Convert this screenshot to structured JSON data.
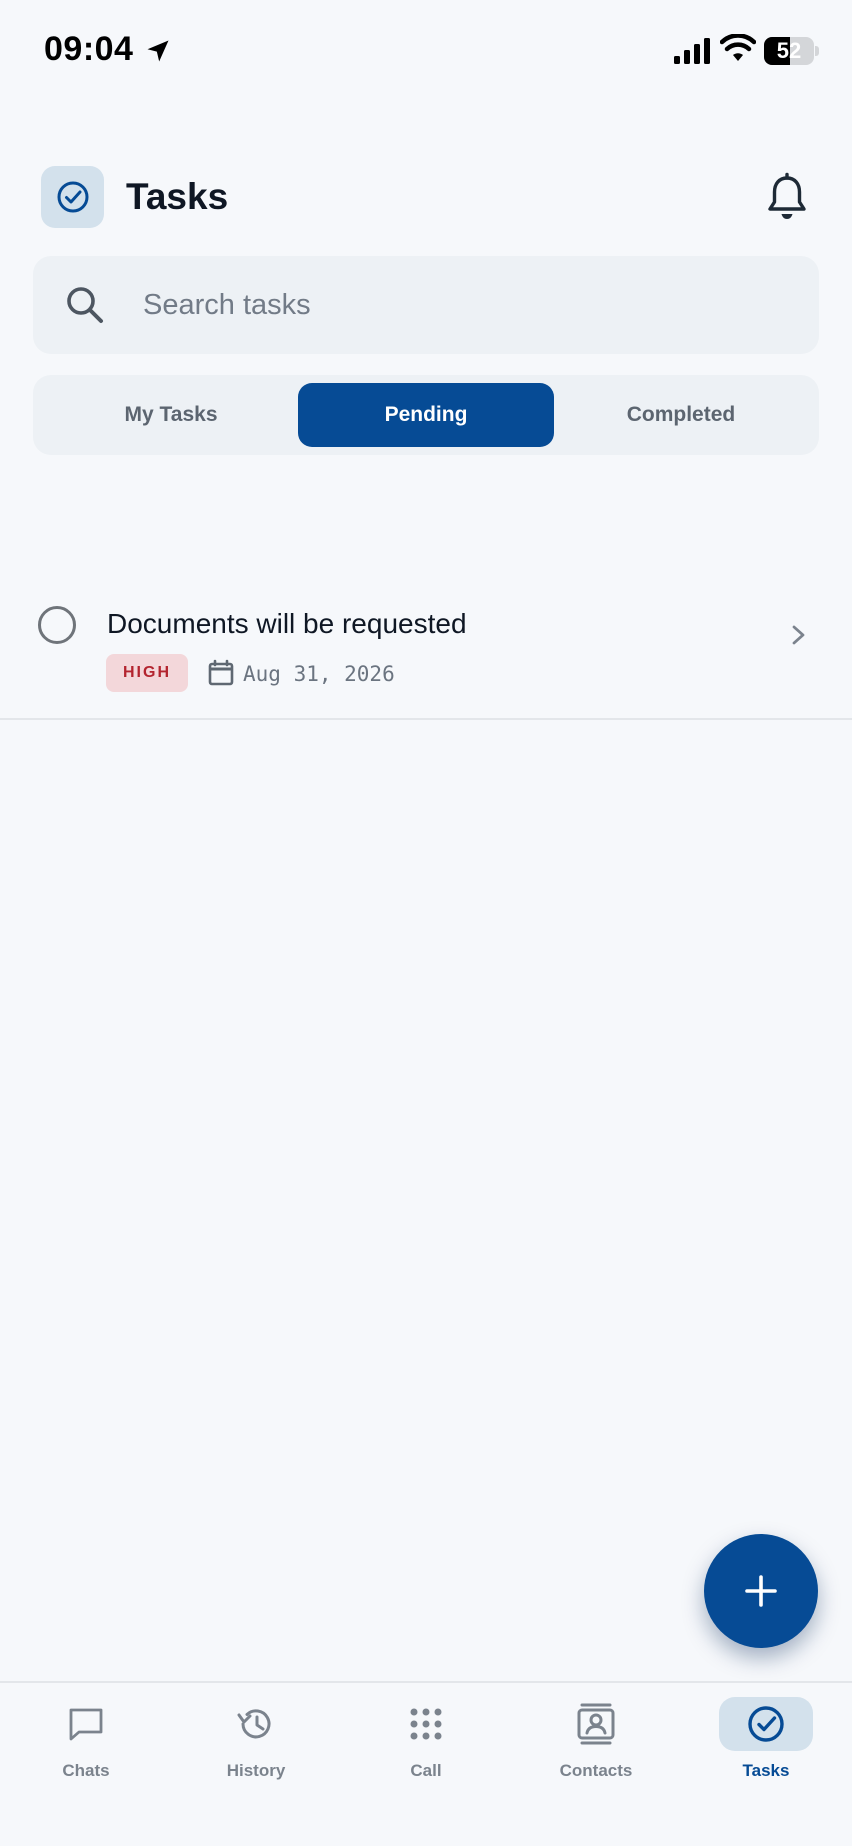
{
  "status_bar": {
    "time": "09:04",
    "battery": "52",
    "battery_level": 0.52
  },
  "header": {
    "title": "Tasks",
    "app_icon": "check-circle-icon",
    "notification_icon": "bell-icon"
  },
  "search": {
    "placeholder": "Search tasks",
    "icon": "search-icon"
  },
  "tabs": [
    {
      "label": "My Tasks",
      "active": false
    },
    {
      "label": "Pending",
      "active": true
    },
    {
      "label": "Completed",
      "active": false
    }
  ],
  "tasks": [
    {
      "title": "Documents will be requested",
      "priority": "HIGH",
      "due_date": "Aug 31, 2026",
      "completed": false
    }
  ],
  "fab": {
    "icon": "plus-icon"
  },
  "bottom_nav": [
    {
      "label": "Chats",
      "icon": "chat-bubble-icon",
      "active": false
    },
    {
      "label": "History",
      "icon": "history-icon",
      "active": false
    },
    {
      "label": "Call",
      "icon": "dialpad-icon",
      "active": false
    },
    {
      "label": "Contacts",
      "icon": "contacts-icon",
      "active": false
    },
    {
      "label": "Tasks",
      "icon": "check-circle-icon",
      "active": true
    }
  ],
  "colors": {
    "accent": "#064b95",
    "background": "#f6f8fb",
    "surface": "#edf1f5",
    "priority_high_bg": "#f3d7da",
    "priority_high_text": "#b3242f"
  }
}
